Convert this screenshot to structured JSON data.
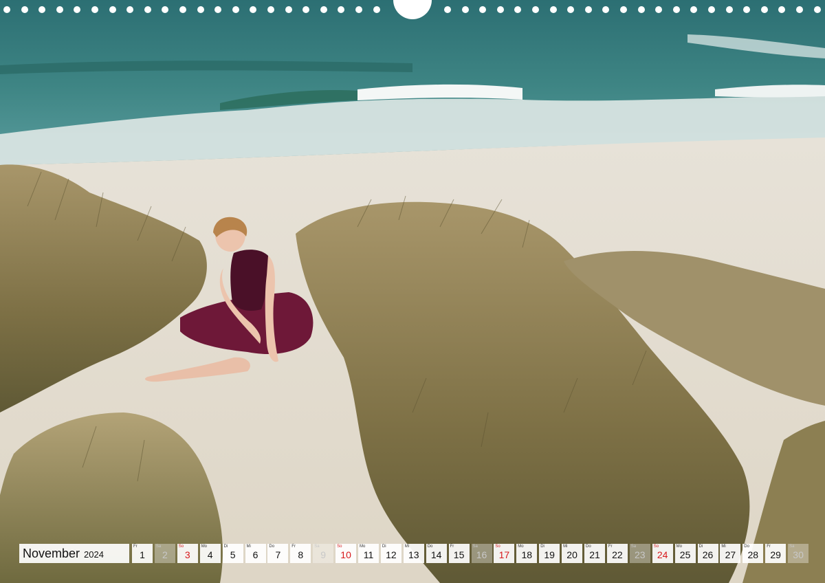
{
  "calendar": {
    "month": "November",
    "year": "2024",
    "days": [
      {
        "wd": "Fr",
        "num": "1",
        "type": "normal"
      },
      {
        "wd": "Sa",
        "num": "2",
        "type": "faded"
      },
      {
        "wd": "So",
        "num": "3",
        "type": "sun"
      },
      {
        "wd": "Mo",
        "num": "4",
        "type": "normal"
      },
      {
        "wd": "Di",
        "num": "5",
        "type": "normal"
      },
      {
        "wd": "Mi",
        "num": "6",
        "type": "normal"
      },
      {
        "wd": "Do",
        "num": "7",
        "type": "normal"
      },
      {
        "wd": "Fr",
        "num": "8",
        "type": "normal"
      },
      {
        "wd": "Sa",
        "num": "9",
        "type": "faded"
      },
      {
        "wd": "So",
        "num": "10",
        "type": "sun"
      },
      {
        "wd": "Mo",
        "num": "11",
        "type": "normal"
      },
      {
        "wd": "Di",
        "num": "12",
        "type": "normal"
      },
      {
        "wd": "Mi",
        "num": "13",
        "type": "normal"
      },
      {
        "wd": "Do",
        "num": "14",
        "type": "normal"
      },
      {
        "wd": "Fr",
        "num": "15",
        "type": "normal"
      },
      {
        "wd": "Sa",
        "num": "16",
        "type": "faded"
      },
      {
        "wd": "So",
        "num": "17",
        "type": "sun"
      },
      {
        "wd": "Mo",
        "num": "18",
        "type": "normal"
      },
      {
        "wd": "Di",
        "num": "19",
        "type": "normal"
      },
      {
        "wd": "Mi",
        "num": "20",
        "type": "normal"
      },
      {
        "wd": "Do",
        "num": "21",
        "type": "normal"
      },
      {
        "wd": "Fr",
        "num": "22",
        "type": "normal"
      },
      {
        "wd": "Sa",
        "num": "23",
        "type": "faded"
      },
      {
        "wd": "So",
        "num": "24",
        "type": "sun"
      },
      {
        "wd": "Mo",
        "num": "25",
        "type": "normal"
      },
      {
        "wd": "Di",
        "num": "26",
        "type": "normal"
      },
      {
        "wd": "Mi",
        "num": "27",
        "type": "normal"
      },
      {
        "wd": "Do",
        "num": "28",
        "type": "normal"
      },
      {
        "wd": "Fr",
        "num": "29",
        "type": "normal"
      },
      {
        "wd": "Sa",
        "num": "30",
        "type": "faded"
      }
    ]
  },
  "colors": {
    "sea": "#2f7a7a",
    "sand": "#e8e2d4",
    "grass": "#8a7a4c",
    "tutu": "#6e1838",
    "sunday_red": "#d7191c"
  }
}
